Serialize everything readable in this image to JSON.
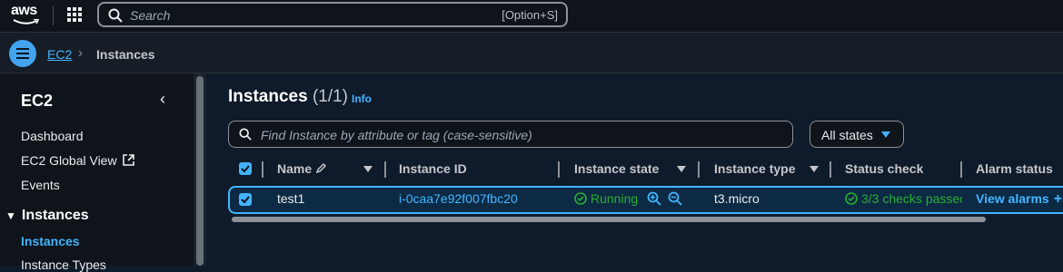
{
  "topbar": {
    "logo_text": "aws",
    "search_placeholder": "Search",
    "search_shortcut": "[Option+S]"
  },
  "breadcrumb": {
    "root": "EC2",
    "current": "Instances"
  },
  "sidebar": {
    "title": "EC2",
    "items": [
      "Dashboard",
      "EC2 Global View",
      "Events"
    ],
    "section": "Instances",
    "active": "Instances",
    "partial": "Instance Types"
  },
  "panel": {
    "title": "Instances",
    "count": "(1/1)",
    "info": "Info",
    "filter_placeholder": "Find Instance by attribute or tag (case-sensitive)",
    "state_filter": "All states"
  },
  "table": {
    "columns": [
      "Name",
      "Instance ID",
      "Instance state",
      "Instance type",
      "Status check",
      "Alarm status"
    ],
    "rows": [
      {
        "name": "test1",
        "instance_id": "i-0caa7e92f007fbc20",
        "state": "Running",
        "type": "t3.micro",
        "status_check": "3/3 checks passec",
        "alarm": "View alarms"
      }
    ]
  },
  "colors": {
    "accent": "#42b4ff",
    "success": "#29ad32",
    "background": "#0f1b2a"
  }
}
